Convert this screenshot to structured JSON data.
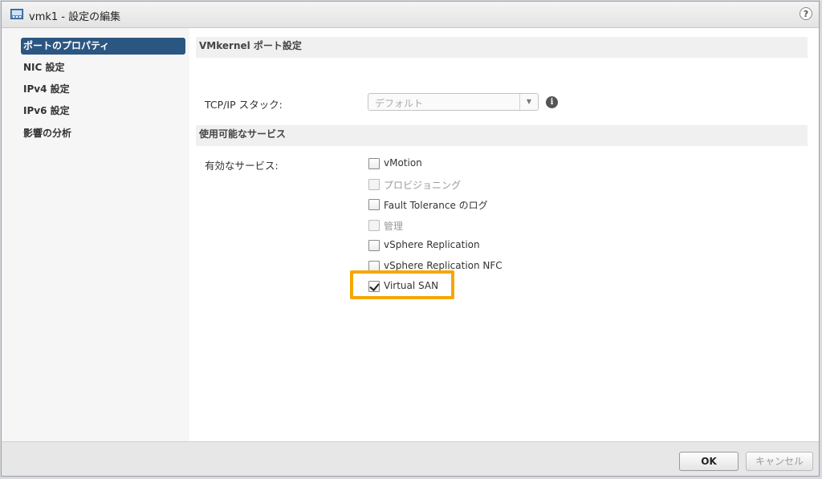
{
  "window": {
    "title": "vmk1 - 設定の編集"
  },
  "sidebar": {
    "items": [
      {
        "label": "ポートのプロパティ",
        "selected": true
      },
      {
        "label": "NIC 設定"
      },
      {
        "label": "IPv4 設定"
      },
      {
        "label": "IPv6 設定"
      },
      {
        "label": "影響の分析"
      }
    ]
  },
  "main": {
    "section_vmkernel": "VMkernel ポート設定",
    "tcpip_label": "TCP/IP スタック:",
    "tcpip_value": "デフォルト",
    "section_services": "使用可能なサービス",
    "enabled_services_label": "有効なサービス:",
    "services": [
      {
        "label": "vMotion",
        "checked": false,
        "disabled": false
      },
      {
        "label": "プロビジョニング",
        "checked": false,
        "disabled": true
      },
      {
        "label": "Fault Tolerance のログ",
        "checked": false,
        "disabled": false
      },
      {
        "label": "管理",
        "checked": false,
        "disabled": true
      },
      {
        "label": "vSphere Replication",
        "checked": false,
        "disabled": false
      },
      {
        "label": "vSphere Replication NFC",
        "checked": false,
        "disabled": false
      },
      {
        "label": "Virtual SAN",
        "checked": true,
        "disabled": false
      }
    ]
  },
  "footer": {
    "ok_label": "OK",
    "cancel_label": "キャンセル"
  },
  "colors": {
    "selected_nav": "#2c5682",
    "highlight": "#f5a700"
  }
}
